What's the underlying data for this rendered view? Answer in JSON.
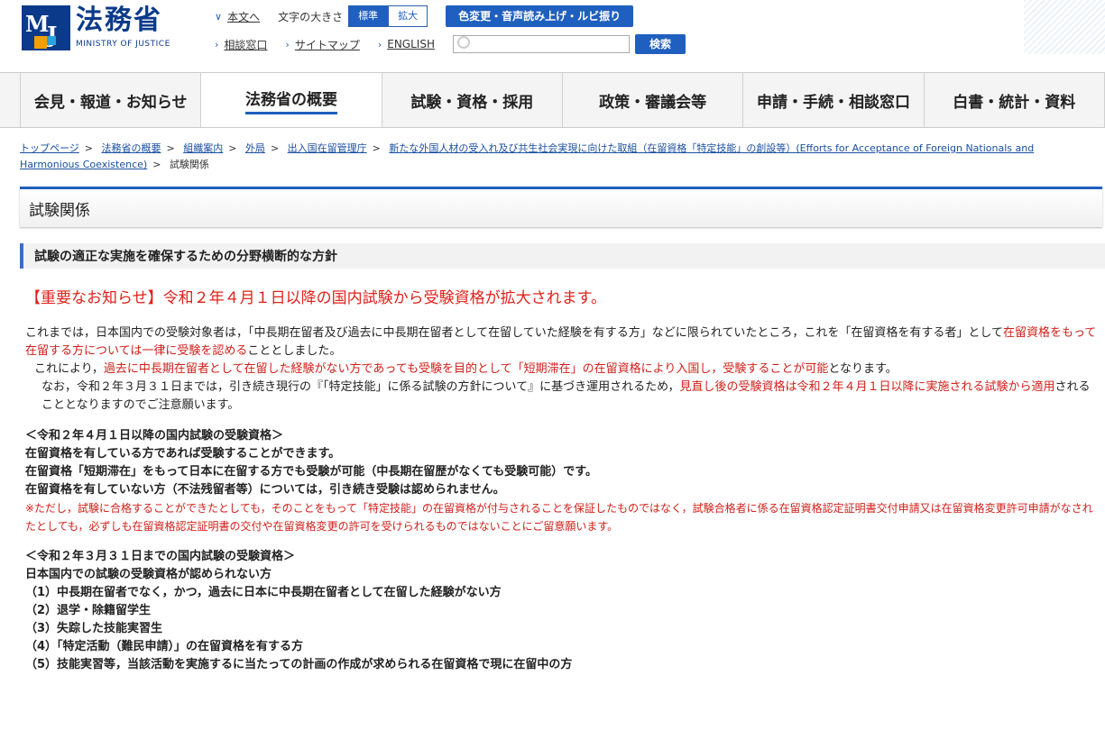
{
  "logo": {
    "kanji": "法務省",
    "en": "MINISTRY OF JUSTICE",
    "mark_m": "M",
    "mark_j": "J"
  },
  "util": {
    "honbun": "本文へ",
    "font_size_label": "文字の大きさ",
    "font_standard": "標準",
    "font_large": "拡大",
    "color_change": "色変更・音声読み上げ・ルビ振り",
    "consult": "相談窓口",
    "sitemap": "サイトマップ",
    "english": "ENGLISH",
    "search_button": "検索"
  },
  "gnav": [
    "会見・報道・お知らせ",
    "法務省の概要",
    "試験・資格・採用",
    "政策・審議会等",
    "申請・手続・相談窓口",
    "白書・統計・資料"
  ],
  "breadcrumb": {
    "items": [
      "トップページ",
      "法務省の概要",
      "組織案内",
      "外局",
      "出入国在留管理庁",
      "新たな外国人材の受入れ及び共生社会実現に向けた取組（在留資格「特定技能」の創設等）(Efforts for Acceptance of Foreign Nationals and Harmonious Coexistence)"
    ],
    "current": "試験関係"
  },
  "page_title": "試験関係",
  "section_heading": "試験の適正な実施を確保するための分野横断的な方針",
  "notice": "【重要なお知らせ】令和２年４月１日以降の国内試験から受験資格が拡大されます。",
  "body": {
    "p1a": "これまでは，日本国内での受験対象者は，「中長期在留者及び過去に中長期在留者として在留していた経験を有する方」などに限られていたところ，これを「在留資格を有する者」として",
    "p1b": "在留資格をもって在留する方については一律に受験を認める",
    "p1c": "こととしました。",
    "p2a": "これにより，",
    "p2b": "過去に中長期在留者として在留した経験がない方であっても受験を目的として「短期滞在」の在留資格により入国し，受験することが可能",
    "p2c": "となります。",
    "p3a": "なお，令和２年３月３１日までは，引き続き現行の『「特定技能」に係る試験の方針について』に基づき運用されるため，",
    "p3b": "見直し後の受験資格は令和２年４月１日以降に実施される試験から適用",
    "p3c": "されることとなりますのでご注意願います。",
    "after_h": "＜令和２年４月１日以降の国内試験の受験資格＞",
    "after_1": "在留資格を有している方であれば受験することができます。",
    "after_2": "在留資格「短期滞在」をもって日本に在留する方でも受験が可能（中長期在留歴がなくても受験可能）です。",
    "after_3": "在留資格を有していない方（不法残留者等）については，引き続き受験は認められません。",
    "after_note": "※ただし，試験に合格することができたとしても，そのことをもって「特定技能」の在留資格が付与されることを保証したものではなく，試験合格者に係る在留資格認定証明書交付申請又は在留資格変更許可申請がなされたとしても，必ずしも在留資格認定証明書の交付や在留資格変更の許可を受けられるものではないことにご留意願います。",
    "before_h": "＜令和２年３月３１日までの国内試験の受験資格＞",
    "before_0": "日本国内での試験の受験資格が認められない方",
    "before_1": "（1）中長期在留者でなく，かつ，過去に日本に中長期在留者として在留した経験がない方",
    "before_2": "（2）退学・除籍留学生",
    "before_3": "（3）失踪した技能実習生",
    "before_4": "（4）「特定活動（難民申請）」の在留資格を有する方",
    "before_5": "（5）技能実習等，当該活動を実施するに当たっての計画の作成が求められる在留資格で現に在留中の方"
  },
  "colors": {
    "accent": "#1f5fbf",
    "notice": "#e0201a"
  }
}
